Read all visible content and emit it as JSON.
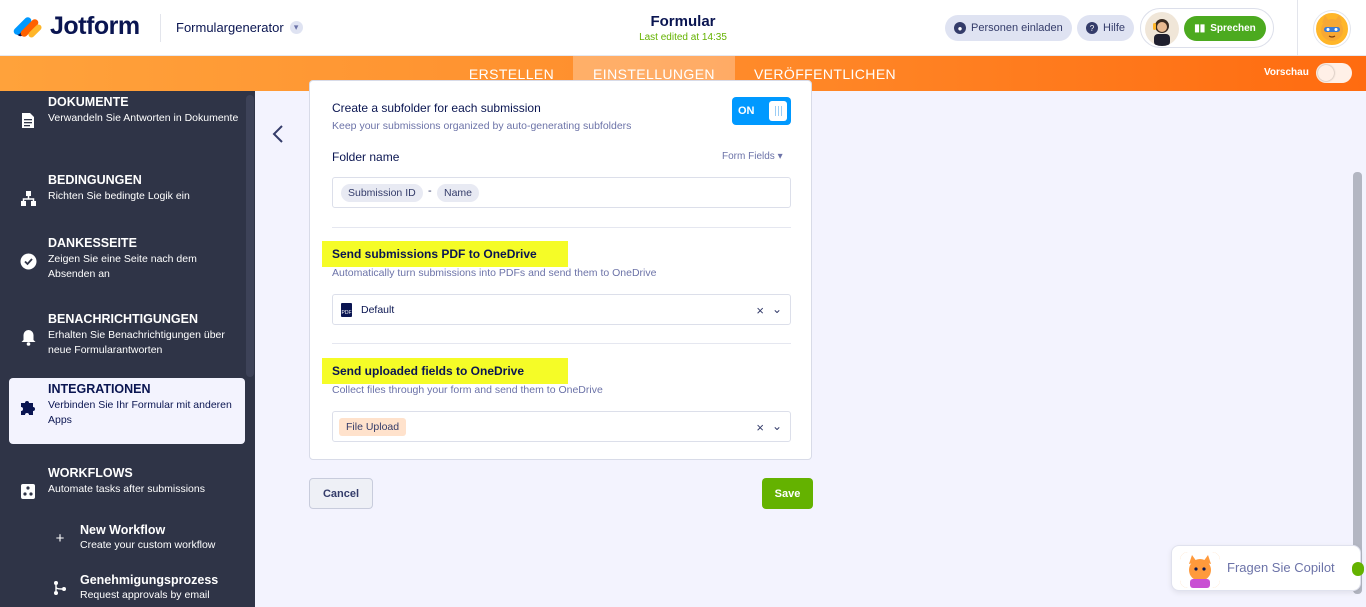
{
  "header": {
    "brand": "Jotform",
    "generator_label": "Formulargenerator",
    "form_title": "Formular",
    "last_edited": "Last edited at 14:35",
    "invite_label": "Personen einladen",
    "help_label": "Hilfe",
    "speak_label": "Sprechen"
  },
  "nav": {
    "tabs": [
      {
        "label": "ERSTELLEN"
      },
      {
        "label": "EINSTELLUNGEN",
        "active": true
      },
      {
        "label": "VERÖFFENTLICHEN"
      }
    ],
    "preview_label": "Vorschau"
  },
  "sidebar": {
    "items": [
      {
        "title": "DOKUMENTE",
        "desc": "Verwandeln Sie Antworten in Dokumente"
      },
      {
        "title": "BEDINGUNGEN",
        "desc": "Richten Sie bedingte Logik ein"
      },
      {
        "title": "DANKESSEITE",
        "desc": "Zeigen Sie eine Seite nach dem Absenden an"
      },
      {
        "title": "BENACHRICHTIGUNGEN",
        "desc": "Erhalten Sie Benachrichtigungen über neue Formularantworten"
      },
      {
        "title": "INTEGRATIONEN",
        "desc": "Verbinden Sie Ihr Formular mit anderen Apps",
        "active": true
      },
      {
        "title": "WORKFLOWS",
        "desc": "Automate tasks after submissions"
      }
    ],
    "sub_items": [
      {
        "title": "New Workflow",
        "desc": "Create your custom workflow"
      },
      {
        "title": "Genehmigungsprozess",
        "desc": "Request approvals by email"
      }
    ]
  },
  "card": {
    "subfolder_title": "Create a subfolder for each submission",
    "subfolder_desc": "Keep your submissions organized by auto-generating subfolders",
    "toggle_label": "ON",
    "folder_name_label": "Folder name",
    "form_fields_link": "Form Fields",
    "folder_chips": [
      "Submission ID",
      "-",
      "Name"
    ],
    "pdf_title": "Send submissions PDF to OneDrive",
    "pdf_desc": "Automatically turn submissions into PDFs and send them to OneDrive",
    "pdf_value": "Default",
    "upload_title": "Send uploaded fields to OneDrive",
    "upload_desc": "Collect files through your form and send them to OneDrive",
    "upload_chip": "File Upload"
  },
  "actions": {
    "cancel_label": "Cancel",
    "save_label": "Save"
  },
  "copilot": {
    "label": "Fragen Sie Copilot"
  },
  "colors": {
    "accent": "#ff6b10",
    "save_green": "#64b200",
    "toggle_blue": "#0099ff",
    "highlight": "#f5fc27",
    "sidebar_bg": "#2f3447"
  }
}
